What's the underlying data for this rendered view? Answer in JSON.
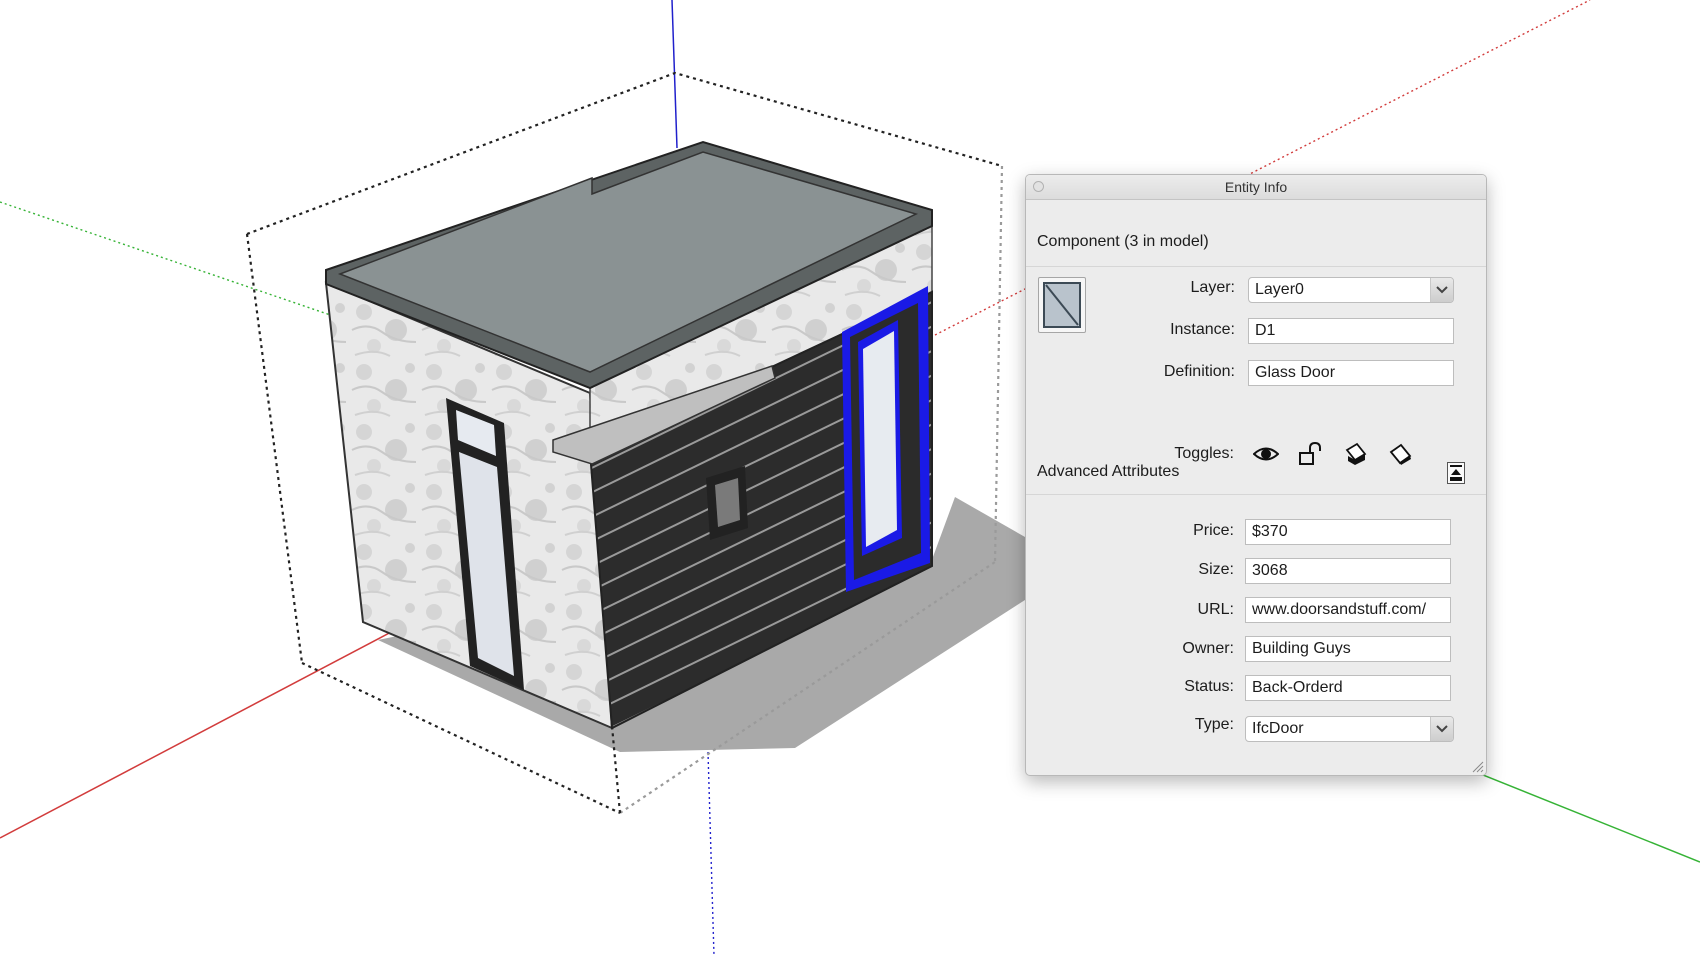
{
  "panel": {
    "title": "Entity Info",
    "component_label": "Component (3 in model)",
    "layer": {
      "label": "Layer:",
      "value": "Layer0"
    },
    "instance": {
      "label": "Instance:",
      "value": "D1"
    },
    "definition": {
      "label": "Definition:",
      "value": "Glass Door"
    },
    "toggles": {
      "label": "Toggles:",
      "icons": [
        "eye-icon",
        "unlock-icon",
        "cast-shadow-icon",
        "receive-shadow-icon"
      ]
    },
    "advanced": {
      "label": "Advanced Attributes",
      "price": {
        "label": "Price:",
        "value": "$370"
      },
      "size": {
        "label": "Size:",
        "value": "3068"
      },
      "url": {
        "label": "URL:",
        "value": "www.doorsandstuff.com/"
      },
      "owner": {
        "label": "Owner:",
        "value": "Building Guys"
      },
      "status": {
        "label": "Status:",
        "value": "Back-Orderd"
      },
      "type": {
        "label": "Type:",
        "value": "IfcDoor"
      }
    }
  },
  "colors": {
    "selection": "#1a1ae6",
    "axis_red": "#d23c3c",
    "axis_green": "#36b336",
    "axis_blue": "#2020cc",
    "roof": "#8a9293",
    "siding": "#2b2b2b",
    "panel_bg": "#ececec"
  }
}
